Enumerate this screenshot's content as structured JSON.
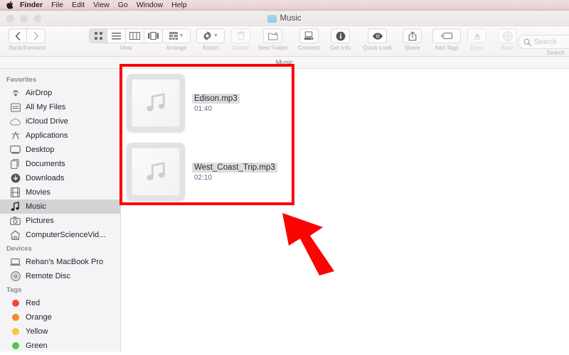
{
  "menubar": {
    "apple_icon": "apple-logo-icon",
    "items": [
      {
        "label": "Finder",
        "bold": true
      },
      {
        "label": "File",
        "bold": false
      },
      {
        "label": "Edit",
        "bold": false
      },
      {
        "label": "View",
        "bold": false
      },
      {
        "label": "Go",
        "bold": false
      },
      {
        "label": "Window",
        "bold": false
      },
      {
        "label": "Help",
        "bold": false
      }
    ]
  },
  "window": {
    "title": "Music",
    "title_icon": "blue-folder-icon",
    "pathbar_text": "Music"
  },
  "toolbar": {
    "nav": {
      "label": "Back/Forward",
      "back_icon": "chevron-left-icon",
      "forward_icon": "chevron-right-icon"
    },
    "view": {
      "label": "View",
      "modes": [
        {
          "name": "icon-view",
          "selected": true
        },
        {
          "name": "list-view",
          "selected": false
        },
        {
          "name": "column-view",
          "selected": false
        },
        {
          "name": "cover-flow-view",
          "selected": false
        }
      ]
    },
    "arrange": {
      "label": "Arrange",
      "icon": "arrange-grid-icon"
    },
    "action": {
      "label": "Action",
      "icon": "gear-icon"
    },
    "delete": {
      "label": "Delete",
      "icon": "trash-icon",
      "disabled": true
    },
    "new_folder": {
      "label": "New Folder",
      "icon": "new-folder-icon"
    },
    "connect": {
      "label": "Connect",
      "icon": "connect-server-icon"
    },
    "get_info": {
      "label": "Get Info",
      "icon": "info-icon"
    },
    "quick_look": {
      "label": "Quick Look",
      "icon": "eye-icon"
    },
    "share": {
      "label": "Share",
      "icon": "share-icon"
    },
    "add_tags": {
      "label": "Add Tags",
      "icon": "tag-icon"
    },
    "eject": {
      "label": "Eject",
      "icon": "eject-icon",
      "disabled": true
    },
    "burn": {
      "label": "Burn",
      "icon": "burn-disc-icon",
      "disabled": true
    },
    "search": {
      "label": "Search",
      "placeholder": "Search",
      "icon": "search-icon"
    }
  },
  "sidebar": {
    "sections": [
      {
        "header": "Favorites",
        "items": [
          {
            "label": "AirDrop",
            "icon": "airdrop-icon",
            "selected": false
          },
          {
            "label": "All My Files",
            "icon": "all-my-files-icon",
            "selected": false
          },
          {
            "label": "iCloud Drive",
            "icon": "icloud-icon",
            "selected": false
          },
          {
            "label": "Applications",
            "icon": "applications-icon",
            "selected": false
          },
          {
            "label": "Desktop",
            "icon": "desktop-icon",
            "selected": false
          },
          {
            "label": "Documents",
            "icon": "documents-icon",
            "selected": false
          },
          {
            "label": "Downloads",
            "icon": "downloads-icon",
            "selected": false
          },
          {
            "label": "Movies",
            "icon": "movies-icon",
            "selected": false
          },
          {
            "label": "Music",
            "icon": "music-note-icon",
            "selected": true
          },
          {
            "label": "Pictures",
            "icon": "pictures-camera-icon",
            "selected": false
          },
          {
            "label": "ComputerScienceVid...",
            "icon": "home-icon",
            "selected": false
          }
        ]
      },
      {
        "header": "Devices",
        "items": [
          {
            "label": "Rehan's MacBook Pro",
            "icon": "laptop-icon",
            "selected": false
          },
          {
            "label": "Remote Disc",
            "icon": "disc-icon",
            "selected": false
          }
        ]
      },
      {
        "header": "Tags",
        "items": [
          {
            "label": "Red",
            "icon": "tag-dot-icon",
            "color": "#f3463f",
            "selected": false
          },
          {
            "label": "Orange",
            "icon": "tag-dot-icon",
            "color": "#f08b2a",
            "selected": false
          },
          {
            "label": "Yellow",
            "icon": "tag-dot-icon",
            "color": "#fac737",
            "selected": false
          },
          {
            "label": "Green",
            "icon": "tag-dot-icon",
            "color": "#4bc94b",
            "selected": false
          }
        ]
      }
    ]
  },
  "files": [
    {
      "name": "Edison.mp3",
      "duration": "01:40",
      "icon": "music-file-icon"
    },
    {
      "name": "West_Coast_Trip.mp3",
      "duration": "02:10",
      "icon": "music-file-icon"
    }
  ],
  "annotations": {
    "highlight_box_color": "#fb0404",
    "pointer_color": "#fb0404",
    "pointer_direction": "up-left"
  }
}
